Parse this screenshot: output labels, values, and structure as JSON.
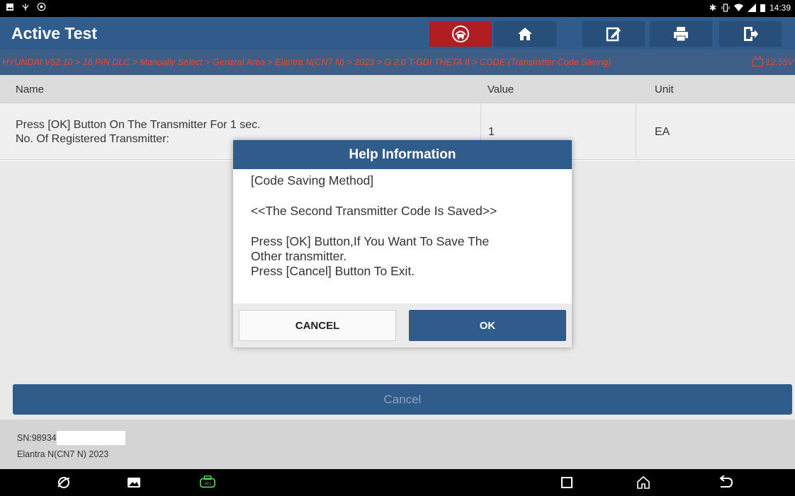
{
  "status_bar": {
    "time": "14:39",
    "left_icons": [
      "gallery-icon",
      "usb-icon",
      "brightness-icon"
    ],
    "right_icons": [
      "bluetooth-icon",
      "vibrate-icon",
      "wifi-icon",
      "signal-icon",
      "battery-icon"
    ]
  },
  "app": {
    "title": "Active Test",
    "toolbar": [
      "remote-diagnosis-icon",
      "home-icon",
      "edit-icon",
      "print-icon",
      "exit-icon"
    ]
  },
  "breadcrumb": {
    "path": "HYUNDAI V52.10 > 16 PIN DLC > Manually Select > General Area > Elantra N(CN7 N) > 2023 > G 2.0 T-GDI THETA II > CODE (Transmitter Code Saving)",
    "voltage": "12.55V"
  },
  "table": {
    "headers": {
      "name": "Name",
      "value": "Value",
      "unit": "Unit"
    },
    "rows": [
      {
        "name_line1": "Press [OK] Button On The Transmitter For 1 sec.",
        "name_line2": "No. Of Registered Transmitter:",
        "value": "1",
        "unit": "EA"
      }
    ]
  },
  "dialog": {
    "title": "Help Information",
    "line1": "[Code Saving Method]",
    "line2": "<<The Second Transmitter Code Is Saved>>",
    "line3a": "Press [OK] Button,If You Want To Save The",
    "line3b": "Other transmitter.",
    "line4": "Press [Cancel] Button To Exit.",
    "cancel_label": "CANCEL",
    "ok_label": "OK"
  },
  "bottom": {
    "cancel_label": "Cancel"
  },
  "footer": {
    "sn": "SN:98934",
    "vehicle": "Elantra N(CN7 N) 2023"
  },
  "nav": [
    "browser-icon",
    "gallery-icon",
    "vci-icon",
    "recents-icon",
    "home-icon",
    "back-icon"
  ],
  "colors": {
    "primary": "#2f5c8a",
    "breadcrumb_bg": "#3d5f87",
    "breadcrumb_text": "#f2462a",
    "alert_red": "#b01e23"
  }
}
